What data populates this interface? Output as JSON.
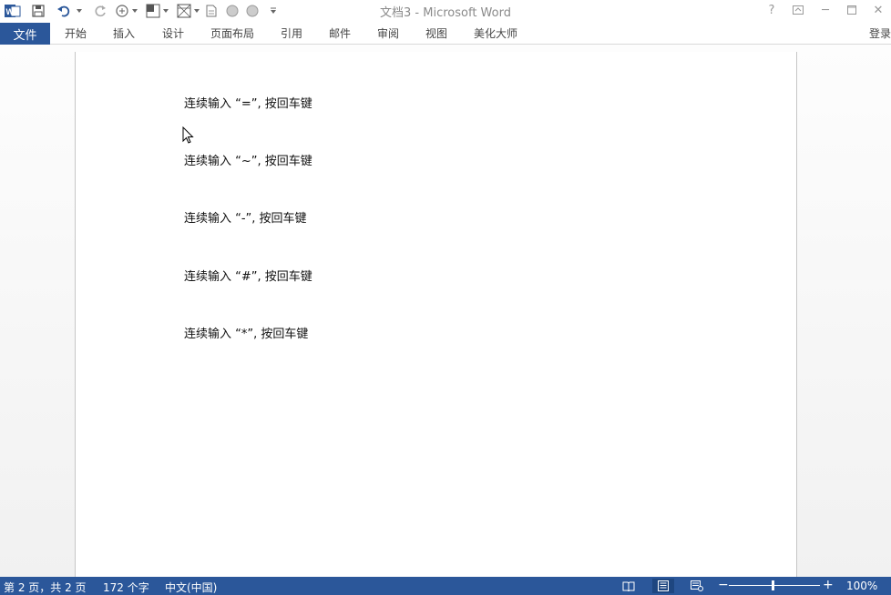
{
  "window": {
    "title": "文档3 - Microsoft Word",
    "help_glyph": "?",
    "minimize_glyph": "─",
    "close_glyph": "✕"
  },
  "quick_access": {
    "icons": [
      "word-logo-icon",
      "save-icon",
      "undo-icon",
      "redo-icon",
      "format-painter-icon",
      "shading-icon",
      "table-icon",
      "document-icon",
      "circle-icon",
      "circle-icon",
      "customize-icon"
    ]
  },
  "ribbon": {
    "file_tab": "文件",
    "tabs": [
      "开始",
      "插入",
      "设计",
      "页面布局",
      "引用",
      "邮件",
      "审阅",
      "视图",
      "美化大师"
    ],
    "login": "登录"
  },
  "document": {
    "paragraphs": [
      "连续输入 “=”, 按回车键",
      "连续输入 “~”, 按回车键",
      "连续输入 “-”, 按回车键",
      "连续输入 “#”, 按回车键",
      "连续输入 “*”, 按回车键"
    ]
  },
  "status": {
    "page_info": "第 2 页，共 2 页",
    "word_count": "172 个字",
    "language": "中文(中国)",
    "zoom_level": "100%",
    "zoom_minus": "−",
    "zoom_plus": "+",
    "zoom_percent_value": 100
  },
  "colors": {
    "accent": "#2b579a",
    "status_bar": "#2b579a"
  }
}
